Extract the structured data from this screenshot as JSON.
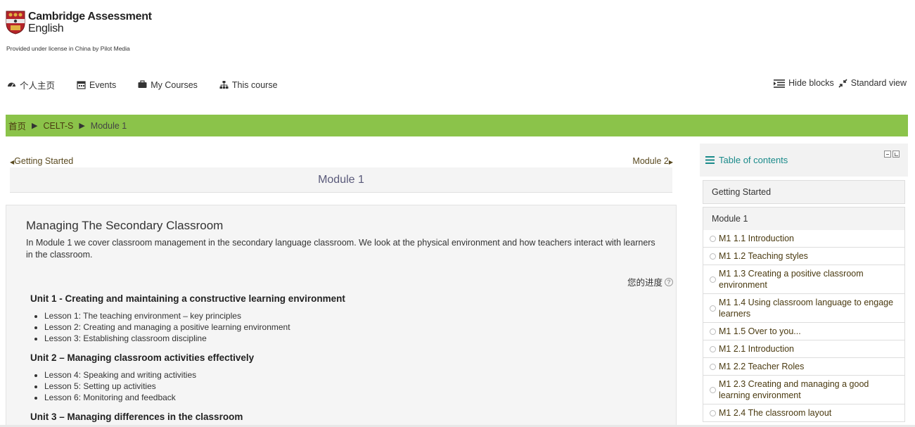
{
  "header": {
    "logo_line1": "Cambridge Assessment",
    "logo_line2": "English",
    "license": "Provided under license in China by Pilot Media"
  },
  "nav": {
    "items": [
      {
        "label": "个人主页",
        "icon": "dashboard-icon"
      },
      {
        "label": "Events",
        "icon": "calendar-icon"
      },
      {
        "label": "My Courses",
        "icon": "briefcase-icon"
      },
      {
        "label": "This course",
        "icon": "sitemap-icon"
      }
    ],
    "right": [
      {
        "label": "Hide blocks",
        "icon": "indent-icon"
      },
      {
        "label": "Standard view",
        "icon": "compress-icon"
      }
    ]
  },
  "breadcrumb": {
    "items": [
      "首页",
      "CELT-S",
      "Module 1"
    ],
    "separator": "▶"
  },
  "main": {
    "prev": "Getting Started",
    "next": "Module 2",
    "module_title": "Module 1",
    "heading": "Managing The Secondary Classroom",
    "intro": "In Module 1 we cover classroom management in the secondary language classroom. We look at the physical environment and how teachers interact with learners in the classroom.",
    "progress_label": "您的进度",
    "units": [
      {
        "title": "Unit 1 - Creating and maintaining a constructive learning environment",
        "lessons": [
          "Lesson 1: The teaching environment – key principles",
          "Lesson 2: Creating and managing a positive learning environment",
          "Lesson 3: Establishing classroom discipline"
        ]
      },
      {
        "title": "Unit 2 –  Managing classroom activities effectively",
        "lessons": [
          "Lesson 4: Speaking and writing activities",
          "Lesson 5: Setting up activities",
          "Lesson 6: Monitoring and feedback"
        ]
      },
      {
        "title": "Unit 3 – Managing differences in the classroom",
        "lessons": []
      }
    ]
  },
  "sidebar": {
    "title": "Table of contents",
    "sections": [
      "Getting Started",
      "Module 1"
    ],
    "items": [
      "M1 1.1 Introduction",
      "M1 1.2 Teaching styles",
      "M1 1.3 Creating a positive classroom environment",
      "M1 1.4 Using classroom language to engage learners",
      "M1 1.5 Over to you...",
      "M1 2.1 Introduction",
      "M1 2.2 Teacher Roles",
      "M1 2.3 Creating and managing a good learning environment",
      "M1 2.4 The classroom layout"
    ]
  },
  "colors": {
    "breadcrumb_bg": "#8bc34a",
    "toc_accent": "#1a8a8a"
  }
}
